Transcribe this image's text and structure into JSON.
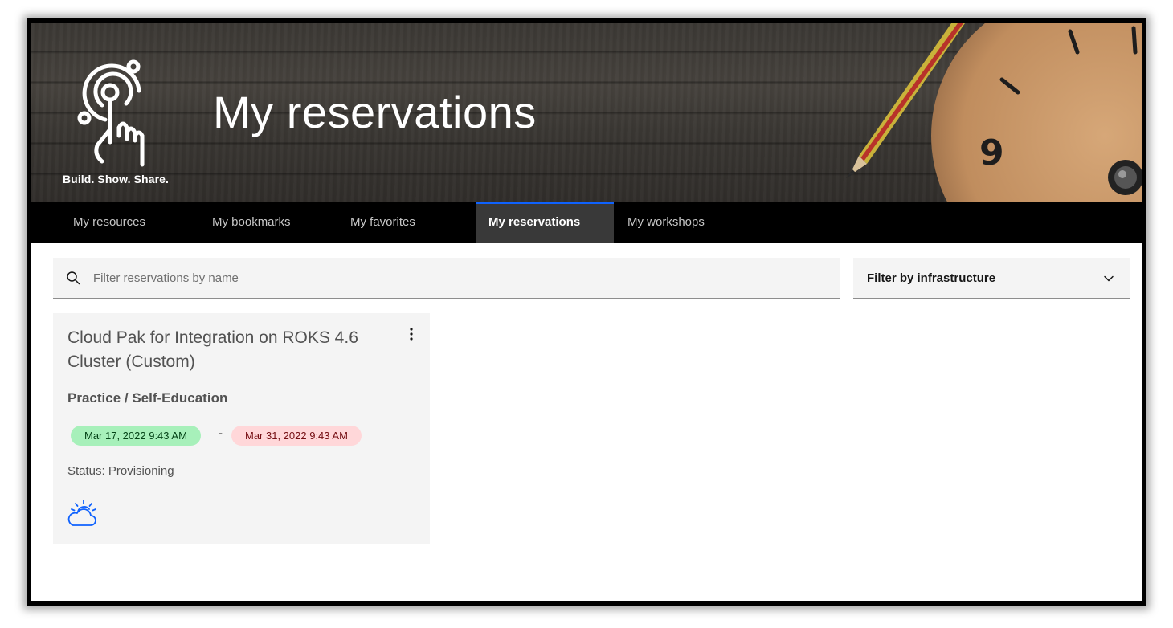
{
  "hero": {
    "title": "My reservations",
    "tagline": "Build. Show. Share.",
    "clock_numeral": "9"
  },
  "tabs": [
    {
      "label": "My resources",
      "active": false
    },
    {
      "label": "My bookmarks",
      "active": false
    },
    {
      "label": "My favorites",
      "active": false
    },
    {
      "label": "My reservations",
      "active": true
    },
    {
      "label": "My workshops",
      "active": false
    }
  ],
  "search": {
    "placeholder": "Filter reservations by name",
    "value": "",
    "icon": "search-icon"
  },
  "filter": {
    "label": "Filter by infrastructure",
    "icon": "chevron-down-icon"
  },
  "cards": [
    {
      "title": "Cloud Pak for Integration on ROKS 4.6 Cluster (Custom)",
      "purpose": "Practice / Self-Education",
      "start": "Mar 17, 2022 9:43 AM",
      "separator": "-",
      "end": "Mar 31, 2022 9:43 AM",
      "status": "Status: Provisioning",
      "icon": "ibm-cloud-icon"
    }
  ],
  "colors": {
    "accent": "#0f62fe",
    "start_pill_bg": "#a7f0ba",
    "end_pill_bg": "#ffd7d9",
    "tab_bar": "#000000",
    "active_tab": "#393939"
  }
}
